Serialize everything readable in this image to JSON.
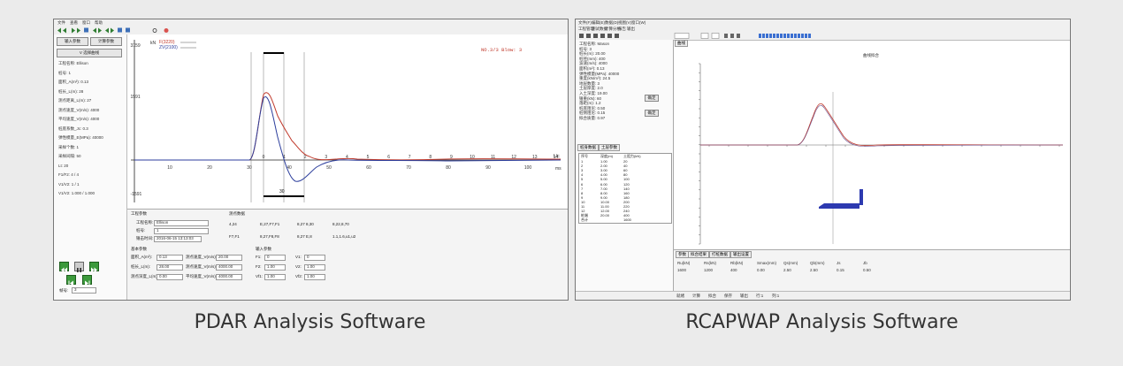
{
  "captions": {
    "pdar": "PDAR Analysis Software",
    "rcapwap": "RCAPWAP Analysis Software"
  },
  "pdar": {
    "menu": [
      "文件",
      "查看",
      "窗口",
      "帮助"
    ],
    "left_buttons": [
      "输入参数",
      "计算参数"
    ],
    "select_button": "V 选择曲线",
    "params": [
      "工程名称: Ellison",
      "桩号: 1",
      "面积_A(m²): 0.13",
      "桩长_L(m): 28",
      "测点距离_L(m): 27",
      "测点速度_V(m/s): 4000",
      "平均速度_V(m/s): 4000",
      "桩底系数_Jc: 0.3",
      "弹性模量_E(MPa): 40000",
      "采样个数: 1",
      "采样间隔: 50",
      "Lt: 20",
      "F1/F2: 4 / 4",
      "V1/V2: 1 / 1",
      "V1/V2: 1.000 / 1.000"
    ],
    "chart": {
      "y_ticks": [
        "3159",
        "1591",
        "-1591"
      ],
      "y_unit": "kN",
      "legend": [
        "F(3220)",
        "ZV(2100)"
      ],
      "status": "NO.3/3 Blow: 3",
      "x_ticks_bottom": [
        "10",
        "20",
        "30",
        "40",
        "50",
        "60",
        "70",
        "80",
        "90",
        "100"
      ],
      "x_ticks_l": [
        "0",
        "1",
        "2",
        "3",
        "4",
        "5",
        "6",
        "7",
        "8",
        "9",
        "10",
        "11",
        "12",
        "13",
        "14"
      ],
      "x_unit_top": "L/c",
      "x_unit_bottom": "ms",
      "marker_label": "30",
      "colors": {
        "force": "#c0392b",
        "velocity": "#2c3e9c",
        "axis": "#222222"
      }
    },
    "form": {
      "group1": "工程参数",
      "fields": [
        {
          "label": "工程名称:",
          "value": "Ellison"
        },
        {
          "label": "桩号:",
          "value": "1"
        },
        {
          "label": "锤击时间:",
          "value": "2016-06-15 13:13:03"
        }
      ],
      "group2": "测点数据",
      "radios": [
        "4,24",
        "E,27,F7,F1",
        "8,27 8,30",
        "8,22,8,70",
        "F7,F1",
        "8,27,F8,F8",
        "8,27 E,8",
        "1.1,1.6,u1,u2"
      ],
      "group3": "基本参数",
      "group4": "输入参数",
      "basic": [
        {
          "label": "面积_A(m²):",
          "value": "0.13"
        },
        {
          "label": "桩长_L(m):",
          "value": "28.00"
        },
        {
          "label": "测点深度_L(m):",
          "value": "0.00"
        },
        {
          "label": "测点速度_V(m/s):",
          "value": "20.00"
        },
        {
          "label": "测点速度_V(m/s):",
          "value": "4000.00"
        },
        {
          "label": "平均速度_V(m/s):",
          "value": "4000.00"
        }
      ],
      "inputs": [
        {
          "label": "F1:",
          "value": "0"
        },
        {
          "label": "V1:",
          "value": "0"
        },
        {
          "label": "F2:",
          "value": "1.00"
        },
        {
          "label": "V2:",
          "value": "1.00"
        },
        {
          "label": "Vf1:",
          "value": "1.00"
        },
        {
          "label": "Vf2:",
          "value": "1.00"
        }
      ]
    },
    "bottom_label": "帧号:",
    "bottom_value": "3"
  },
  "rcapwap": {
    "menu": [
      "文件(F)",
      "编辑(E)",
      "数据(D)",
      "视图(V)",
      "窗口(W)"
    ],
    "menu2": [
      "工程管理",
      "测试数据",
      "计算分析",
      "报告",
      "输出"
    ],
    "tab_top": "曲线",
    "chart_title": "曲线拟合",
    "params": [
      "工程名称: Mason",
      "桩号: 3",
      "桩长(m): 20.00",
      "桩径(mm): 400",
      "波速(m/s): 4000",
      "面积(m²): 0.13",
      "弹性模量(MPa): 40000",
      "重度(kN/m³): 24.5",
      "地层数量: 3",
      "土层厚度: 2.0",
      "入土深度: 19.00",
      "锤重(kN): 60",
      "落距(m): 1.2",
      "桩底阻尼: 0.50",
      "桩侧阻尼: 0.15",
      "拟合质量: 0.97"
    ],
    "btn_a": "确定",
    "btn_b": "确定",
    "tabs_mid": [
      "桩身数据",
      "土层参数"
    ],
    "table_head": [
      "序号",
      "深度(m)",
      "土阻力(kN)"
    ],
    "table_rows": [
      [
        "1",
        "1.00",
        "20"
      ],
      [
        "2",
        "2.00",
        "40"
      ],
      [
        "3",
        "3.00",
        "60"
      ],
      [
        "4",
        "4.00",
        "80"
      ],
      [
        "5",
        "5.00",
        "100"
      ],
      [
        "6",
        "6.00",
        "120"
      ],
      [
        "7",
        "7.00",
        "140"
      ],
      [
        "8",
        "8.00",
        "160"
      ],
      [
        "9",
        "9.00",
        "180"
      ],
      [
        "10",
        "10.00",
        "200"
      ],
      [
        "11",
        "11.00",
        "220"
      ],
      [
        "12",
        "12.00",
        "240"
      ],
      [
        "桩端",
        "20.00",
        "400"
      ],
      [
        "合计",
        "",
        "1600"
      ]
    ],
    "bottom_tabs": [
      "参数",
      "拟合结果",
      "打桩数据",
      "输出设置"
    ],
    "bottom_cols": [
      "Ru(kN)",
      "Rs(kN)",
      "Rb(kN)",
      "Smax(mm)",
      "Qs(mm)",
      "Qb(mm)",
      "Js",
      "Jb"
    ],
    "bottom_vals": [
      "1600",
      "1200",
      "400",
      "0.00",
      "2.50",
      "2.50",
      "0.15",
      "0.50"
    ],
    "status_items": [
      "就绪",
      "计算",
      "拟合",
      "保存",
      "输出",
      "行:1",
      "列:1"
    ]
  }
}
